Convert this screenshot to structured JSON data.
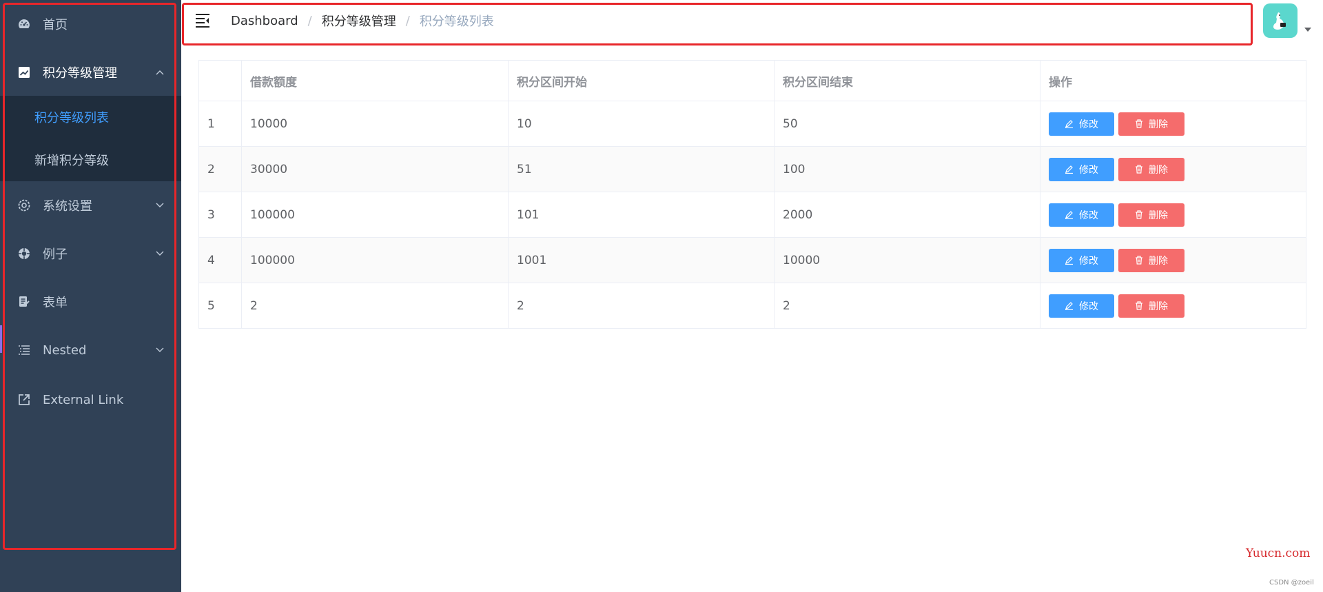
{
  "sidebar": {
    "items": [
      {
        "label": "首页"
      },
      {
        "label": "积分等级管理"
      },
      {
        "label": "系统设置"
      },
      {
        "label": "例子"
      },
      {
        "label": "表单"
      },
      {
        "label": "Nested"
      },
      {
        "label": "External Link"
      }
    ],
    "submenu": [
      {
        "label": "积分等级列表",
        "active": true
      },
      {
        "label": "新增积分等级"
      }
    ]
  },
  "navbar": {
    "breadcrumb": [
      "Dashboard",
      "积分等级管理",
      "积分等级列表"
    ],
    "separator": "/"
  },
  "table": {
    "columns": [
      "",
      "借款额度",
      "积分区间开始",
      "积分区间结束",
      "操作"
    ],
    "rows": [
      [
        "1",
        "10000",
        "10",
        "50"
      ],
      [
        "2",
        "30000",
        "51",
        "100"
      ],
      [
        "3",
        "100000",
        "101",
        "2000"
      ],
      [
        "4",
        "100000",
        "1001",
        "10000"
      ],
      [
        "5",
        "2",
        "2",
        "2"
      ]
    ],
    "edit_label": "修改",
    "delete_label": "删除"
  },
  "watermark": "Yuucn.com",
  "credit": "CSDN @zoeil",
  "colors": {
    "sidebar_bg": "#304156",
    "submenu_bg": "#1f2d3d",
    "active": "#409eff",
    "danger": "#f56c6c",
    "highlight": "#e8262a"
  }
}
